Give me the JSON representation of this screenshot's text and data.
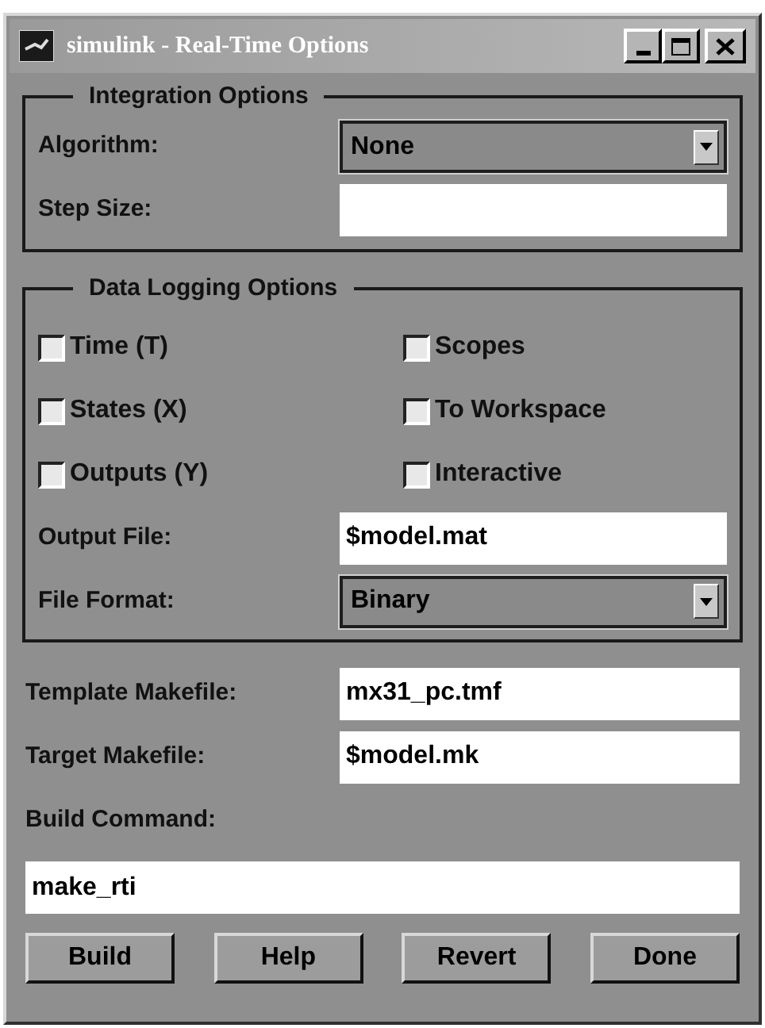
{
  "window": {
    "title": "simulink - Real-Time Options"
  },
  "integration_options": {
    "title": "Integration Options",
    "fields": [
      {
        "kind": "dropdown",
        "label": "Algorithm:",
        "value": "None"
      },
      {
        "kind": "text",
        "label": "Step Size:"
      }
    ]
  },
  "data_logging_options": {
    "title": "Data Logging Options",
    "checkboxes": [
      {
        "label": "Time (T)",
        "checked": false
      },
      {
        "label": "Scopes",
        "checked": false
      },
      {
        "label": "States (X)",
        "checked": false
      },
      {
        "label": "To Workspace",
        "checked": false
      },
      {
        "label": "Outputs (Y)",
        "checked": false
      },
      {
        "label": "Interactive",
        "checked": false
      }
    ],
    "fields": [
      {
        "kind": "text",
        "label": "Output File:",
        "value": "$model.mat"
      },
      {
        "kind": "dropdown",
        "label": "File Format:",
        "value": "Binary"
      }
    ]
  },
  "fields": [
    {
      "kind": "text",
      "label": "Template Makefile:",
      "value": "mx31_pc.tmf"
    },
    {
      "kind": "text",
      "label": "Target Makefile:",
      "value": "$model.mk"
    }
  ],
  "build_command": {
    "label": "Build Command:",
    "value": "make_rti"
  },
  "buttons": [
    "Build",
    "Help",
    "Revert",
    "Done"
  ]
}
